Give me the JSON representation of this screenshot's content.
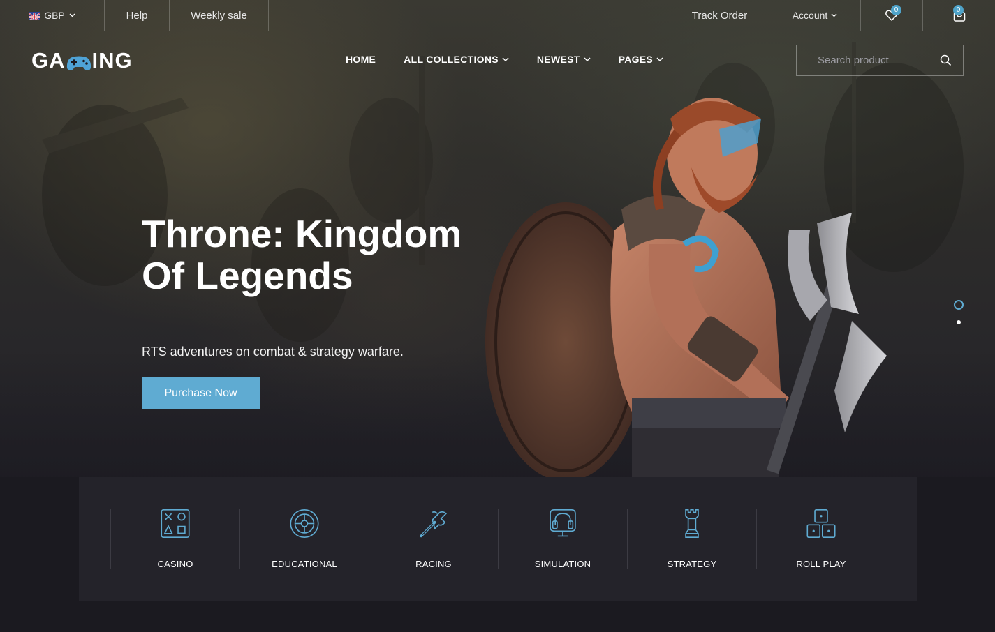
{
  "topbar": {
    "currency": "GBP",
    "help": "Help",
    "weekly_sale": "Weekly sale",
    "track_order": "Track Order",
    "account": "Account",
    "wishlist_count": "0",
    "cart_count": "0"
  },
  "header": {
    "logo_left": "GA",
    "logo_right": "ING",
    "nav": [
      {
        "label": "HOME"
      },
      {
        "label": "ALL COLLECTIONS"
      },
      {
        "label": "NEWEST"
      },
      {
        "label": "PAGES"
      }
    ],
    "search_placeholder": "Search product"
  },
  "hero": {
    "title_line1": "Throne: Kingdom",
    "title_line2": "Of Legends",
    "subtitle": "RTS adventures on combat & strategy warfare.",
    "cta": "Purchase Now",
    "slides": 2,
    "active_slide": 1
  },
  "categories": [
    {
      "label": "CASINO",
      "icon": "casino-icon"
    },
    {
      "label": "EDUCATIONAL",
      "icon": "educational-icon"
    },
    {
      "label": "RACING",
      "icon": "racing-icon"
    },
    {
      "label": "SIMULATION",
      "icon": "simulation-icon"
    },
    {
      "label": "STRATEGY",
      "icon": "strategy-icon"
    },
    {
      "label": "ROLL PLAY",
      "icon": "roll-play-icon"
    }
  ],
  "colors": {
    "accent": "#5fabd2",
    "background": "#1b1a20",
    "panel": "#24232a"
  }
}
